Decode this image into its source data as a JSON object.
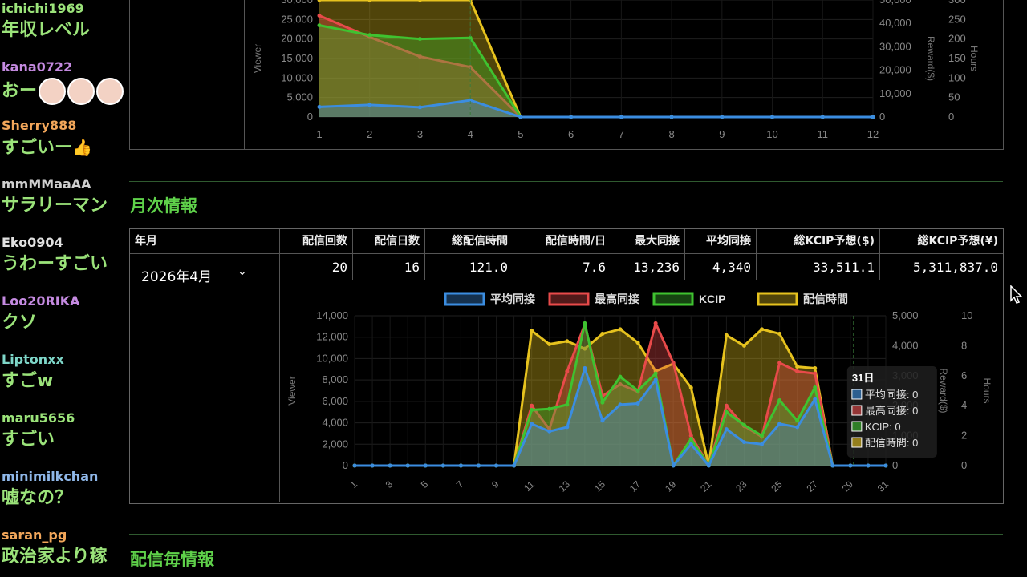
{
  "chat": [
    {
      "user": "ichichi1969",
      "color": "#9be37a",
      "msg": "年収レベル",
      "y": 2
    },
    {
      "user": "kana0722",
      "color": "#c48ae0",
      "msg": "おー",
      "faces": 3,
      "y": 75
    },
    {
      "user": "Sherry888",
      "color": "#f2a65a",
      "msg": "すごいー",
      "thumb": "👍",
      "y": 148
    },
    {
      "user": "mmMMaaAA",
      "color": "#cfcfcf",
      "msg": "サラリーマン",
      "y": 221
    },
    {
      "user": "Eko0904",
      "color": "#e0e0e0",
      "msg": "うわーすごい",
      "y": 294
    },
    {
      "user": "Loo20RIKA",
      "color": "#c48ae0",
      "msg": "クソ",
      "y": 367
    },
    {
      "user": "Liptonxx",
      "color": "#7ed6c8",
      "msg": "すごw",
      "y": 440
    },
    {
      "user": "maru5656",
      "color": "#9be37a",
      "msg": "すごい",
      "y": 513
    },
    {
      "user": "minimilkchan",
      "color": "#8fb7e8",
      "msg": "嘘なの？",
      "y": 586
    },
    {
      "user": "saran_pg",
      "color": "#f2a65a",
      "msg": "政治家より稼",
      "y": 659
    }
  ],
  "sections": {
    "monthly_title": "月次情報",
    "per_stream_title": "配信毎情報"
  },
  "monthly_table": {
    "headers": [
      "年月",
      "配信回数",
      "配信日数",
      "総配信時間",
      "配信時間/日",
      "最大同接",
      "平均同接",
      "総KCIP予想($)",
      "総KCIP予想(¥)"
    ],
    "selected_month": "2026年4月",
    "values": [
      "20",
      "16",
      "121.0",
      "7.6",
      "13,236",
      "4,340",
      "33,511.1",
      "5,311,837.0"
    ]
  },
  "chart_data": [
    {
      "type": "area",
      "x": [
        1,
        2,
        3,
        4,
        5,
        6,
        7,
        8,
        9,
        10,
        11,
        12
      ],
      "ylabel": "Viewer",
      "y2label": "Reward($)",
      "y3label": "Hours",
      "ylim": [
        0,
        30000
      ],
      "y2lim": [
        0,
        50000
      ],
      "y3lim": [
        0,
        300
      ],
      "yticks": [
        "0",
        "5,000",
        "10,000",
        "15,000",
        "20,000",
        "25,000",
        "30,000"
      ],
      "y2ticks": [
        "0",
        "10,000",
        "20,000",
        "30,000",
        "40,000",
        "50,000"
      ],
      "y3ticks": [
        "0",
        "50",
        "100",
        "150",
        "200",
        "250",
        "300"
      ],
      "series": [
        {
          "name": "平均同接",
          "color": "#3b8de0",
          "values": [
            2600,
            3100,
            2500,
            4300,
            0,
            0,
            0,
            0,
            0,
            0,
            0,
            0
          ]
        },
        {
          "name": "最高同接",
          "color": "#e84a4a",
          "values": [
            26000,
            20500,
            15500,
            12800,
            0,
            0,
            0,
            0,
            0,
            0,
            0,
            0
          ]
        },
        {
          "name": "KCIP",
          "color": "#3fc230",
          "values": [
            23500,
            21000,
            20000,
            20300,
            0,
            0,
            0,
            0,
            0,
            0,
            0,
            0
          ]
        },
        {
          "name": "配信時間",
          "color": "#e6c21e",
          "values": [
            23200,
            17500,
            20500,
            14000,
            0,
            0,
            0,
            0,
            0,
            0,
            0,
            0
          ]
        }
      ]
    },
    {
      "type": "area",
      "x": [
        1,
        2,
        3,
        4,
        5,
        6,
        7,
        8,
        9,
        10,
        11,
        12,
        13,
        14,
        15,
        16,
        17,
        18,
        19,
        20,
        21,
        22,
        23,
        24,
        25,
        26,
        27,
        28,
        29,
        30,
        31
      ],
      "xticks": [
        "1",
        "3",
        "5",
        "7",
        "9",
        "11",
        "13",
        "15",
        "17",
        "19",
        "21",
        "23",
        "25",
        "27",
        "29",
        "31"
      ],
      "ylabel": "Viewer",
      "y2label": "Reward($)",
      "y3label": "Hours",
      "ylim": [
        0,
        14000
      ],
      "y2lim": [
        0,
        5000
      ],
      "y3lim": [
        0,
        10
      ],
      "yticks": [
        "0",
        "2,000",
        "4,000",
        "6,000",
        "8,000",
        "10,000",
        "12,000",
        "14,000"
      ],
      "y2ticks": [
        "0",
        "1,000",
        "2,000",
        "3,000",
        "4,000",
        "5,000"
      ],
      "y3ticks": [
        "0",
        "2",
        "4",
        "6",
        "8",
        "10"
      ],
      "legend": [
        "平均同接",
        "最高同接",
        "KCIP",
        "配信時間"
      ],
      "series": [
        {
          "name": "平均同接",
          "color": "#3b8de0",
          "values": [
            0,
            0,
            0,
            0,
            0,
            0,
            0,
            0,
            0,
            0,
            3900,
            3200,
            3600,
            9100,
            4200,
            5700,
            5800,
            8000,
            0,
            2000,
            0,
            3400,
            2200,
            2000,
            3900,
            3600,
            6200,
            0,
            0,
            0,
            0
          ]
        },
        {
          "name": "最高同接",
          "color": "#e84a4a",
          "values": [
            0,
            0,
            0,
            0,
            0,
            0,
            0,
            0,
            0,
            0,
            5600,
            3400,
            8800,
            13200,
            6500,
            7600,
            6900,
            13300,
            9600,
            2800,
            0,
            5600,
            3700,
            2700,
            9600,
            8800,
            8600,
            0,
            0,
            0,
            0
          ]
        },
        {
          "name": "KCIP",
          "color": "#3fc230",
          "values": [
            0,
            0,
            0,
            0,
            0,
            0,
            0,
            0,
            0,
            0,
            5200,
            5300,
            5700,
            13300,
            5900,
            8300,
            7000,
            8600,
            0,
            2500,
            0,
            5000,
            3800,
            2800,
            6100,
            4200,
            7300,
            0,
            0,
            0,
            0
          ]
        },
        {
          "name": "配信時間",
          "color": "#e6c21e",
          "values": [
            0,
            0,
            0,
            0,
            0,
            0,
            0,
            0,
            0,
            0,
            9.0,
            8.1,
            8.3,
            7.8,
            8.8,
            9.1,
            8.2,
            6.3,
            6.8,
            5.2,
            0,
            8.7,
            8.0,
            9.1,
            8.8,
            6.6,
            6.5,
            0,
            0,
            0,
            0
          ]
        }
      ],
      "tooltip": {
        "title": "31日",
        "lines": [
          "平均同接: 0",
          "最高同接: 0",
          "KCIP: 0",
          "配信時間: 0"
        ]
      }
    }
  ]
}
